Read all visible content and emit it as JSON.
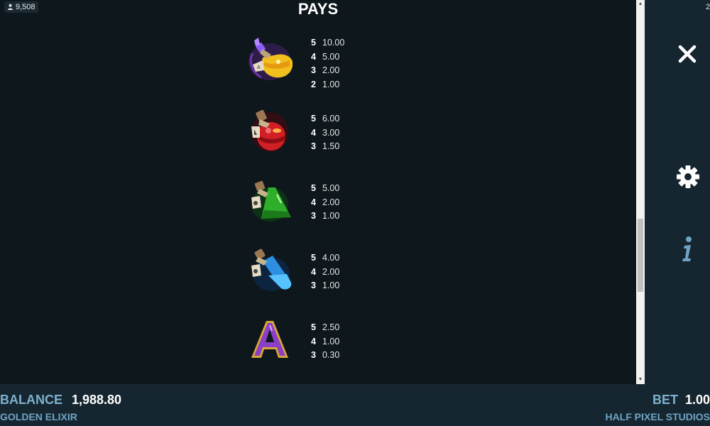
{
  "header": {
    "players_count": "9,508",
    "corner_text": "2",
    "title": "PAYS"
  },
  "paytable": [
    {
      "symbol_name": "yellow-elixir-potion-icon",
      "color": "#f2c01d",
      "pays": [
        {
          "count": "5",
          "amount": "10.00"
        },
        {
          "count": "4",
          "amount": "5.00"
        },
        {
          "count": "3",
          "amount": "2.00"
        },
        {
          "count": "2",
          "amount": "1.00"
        }
      ]
    },
    {
      "symbol_name": "red-elixir-potion-icon",
      "color": "#d11f26",
      "pays": [
        {
          "count": "5",
          "amount": "6.00"
        },
        {
          "count": "4",
          "amount": "3.00"
        },
        {
          "count": "3",
          "amount": "1.50"
        }
      ]
    },
    {
      "symbol_name": "green-elixir-potion-icon",
      "color": "#2fae2a",
      "pays": [
        {
          "count": "5",
          "amount": "5.00"
        },
        {
          "count": "4",
          "amount": "2.00"
        },
        {
          "count": "3",
          "amount": "1.00"
        }
      ]
    },
    {
      "symbol_name": "blue-elixir-potion-icon",
      "color": "#2c8fe0",
      "pays": [
        {
          "count": "5",
          "amount": "4.00"
        },
        {
          "count": "4",
          "amount": "2.00"
        },
        {
          "count": "3",
          "amount": "1.00"
        }
      ]
    },
    {
      "symbol_name": "letter-a-symbol-icon",
      "letter": "A",
      "color": "#8a3fc7",
      "pays": [
        {
          "count": "5",
          "amount": "2.50"
        },
        {
          "count": "4",
          "amount": "1.00"
        },
        {
          "count": "3",
          "amount": "0.30"
        }
      ]
    }
  ],
  "side_panel": {
    "close_icon": "close-icon",
    "settings_icon": "gear-icon",
    "info_icon": "info-icon"
  },
  "footer": {
    "balance_label": "BALANCE",
    "balance_value": "1,988.80",
    "game_name": "GOLDEN ELIXIR",
    "bet_label": "BET",
    "bet_value": "1.00",
    "studio": "HALF PIXEL STUDIOS"
  },
  "colors": {
    "accent_label": "#7fb1cf",
    "background": "#0e171c",
    "panel": "#162630"
  }
}
